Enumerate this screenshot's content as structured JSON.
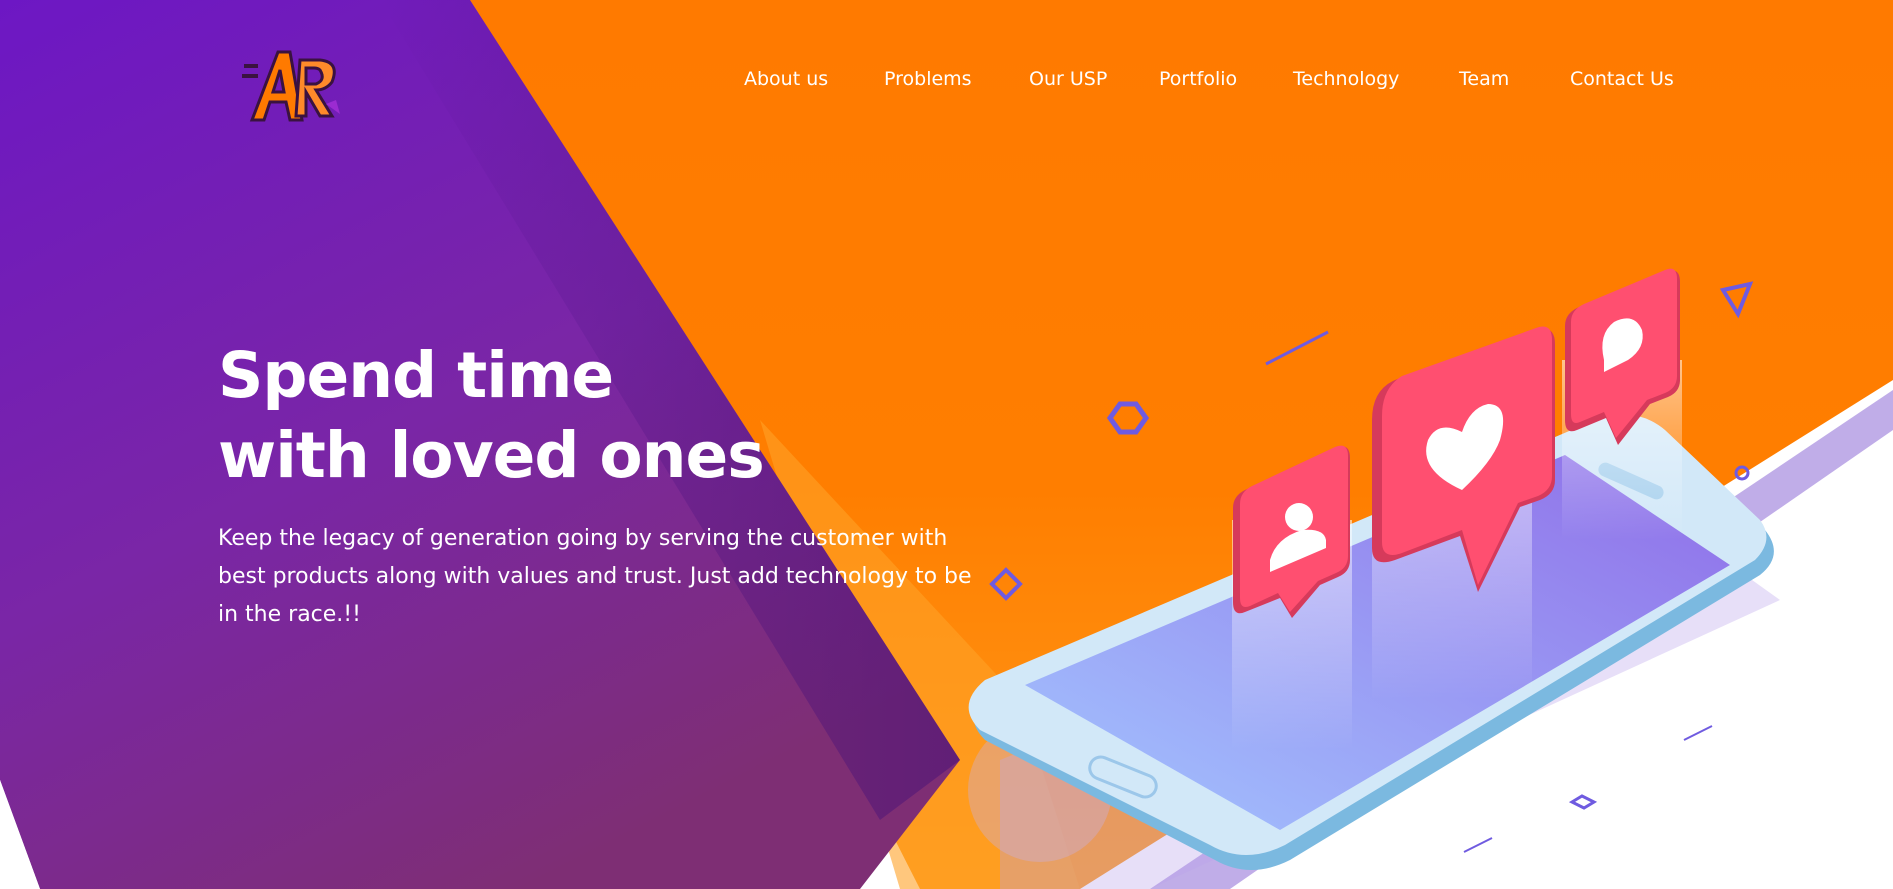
{
  "brand": {
    "logo_text": "AR",
    "colors": {
      "purple": "#6a1ab5",
      "orange": "#ff7a00",
      "heart": "#ff4d6d"
    }
  },
  "nav": {
    "items": [
      {
        "label": "About us"
      },
      {
        "label": "Problems"
      },
      {
        "label": "Our USP"
      },
      {
        "label": "Portfolio"
      },
      {
        "label": "Technology"
      },
      {
        "label": "Team"
      },
      {
        "label": "Contact Us"
      }
    ]
  },
  "hero": {
    "headline_line1": "Spend time",
    "headline_line2": "with loved ones",
    "subtext": "Keep the legacy of generation going by serving the customer with best products along with values and trust. Just add technology to be in the race.!!"
  },
  "illustration": {
    "icons": [
      "user-notification-icon",
      "heart-notification-icon",
      "comment-notification-icon",
      "smartphone-icon"
    ]
  }
}
